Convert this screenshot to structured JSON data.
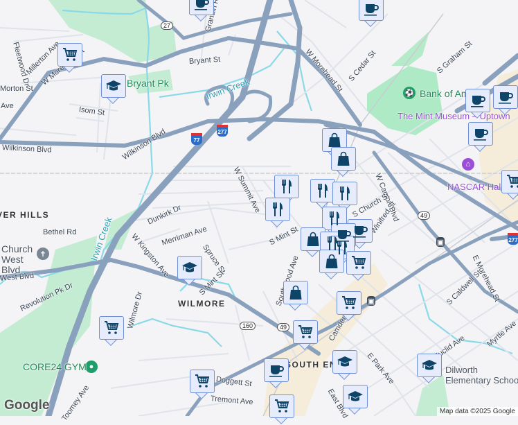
{
  "labels": {
    "fleetwood": "Fleetwood Dr",
    "millerton": "Millerton Ave",
    "w_morehead_w": "W Morehead St",
    "morton": "Morton St",
    "ave": "Ave",
    "isom": "Isom St",
    "bryant_st": "Bryant St",
    "grandin": "Grandin Rd",
    "wilkinson_1": "Wilkinson Blvd",
    "wilkinson_2": "Wilkinson Blvd",
    "w_summit": "W Summit Ave",
    "w_morehead_e": "W Morehead St",
    "s_cedar": "S Cedar St",
    "s_graham": "S Graham St",
    "w_carson": "W Carson Blvd",
    "s_church": "S Church St",
    "winifred": "Winifred St",
    "dunkirk": "Dunkirk Dr",
    "merriman": "Merriman Ave",
    "w_kingston": "W Kingston Ave",
    "spruce": "Spruce St",
    "s_mint_1": "S Mint St",
    "s_mint_2": "S Mint St",
    "bethel": "Bethel Rd",
    "west_blvd": "West Blvd",
    "revolution": "Revolution Pk Dr",
    "wilmore_dr": "Wilmore Dr",
    "southwood": "Southwood Ave",
    "camden": "Camden Rd",
    "e_park": "E Park Ave",
    "s_caldwell": "S Caldwell St",
    "e_morehead": "E Morehead St",
    "myrtle": "Myrtle Ave",
    "euclid": "Euclid Ave",
    "doggett": "Doggett St",
    "tremont": "Tremont Ave",
    "toomey": "Toomey Ave",
    "east": "East Blvd",
    "river_hills": "RIVER HILLS",
    "wilmore": "WILMORE",
    "south_end": "SOUTH END",
    "bryant_pk": "Bryant Pk",
    "irwin_creek_1": "Irwin Creek",
    "irwin_creek_2": "Irwin Creek",
    "bank_of_america": "Bank of America Stadium",
    "mint_museum": "The Mint Museum – Uptown",
    "nascar": "NASCAR Hall of Fame",
    "church": "Church West Blvd",
    "core24": "CORE24 GYM",
    "dilworth": "Dilworth Elementary School"
  },
  "shields": {
    "us27": "27",
    "us49a": "49",
    "us49b": "49",
    "nc160": "160",
    "i77": "77",
    "i277a": "277",
    "i277b": "277"
  },
  "markers": [
    "cart",
    "graduation-cap",
    "coffee",
    "coffee",
    "shopping-bag",
    "shopping-bag",
    "coffee",
    "coffee",
    "coffee",
    "cart",
    "restaurant",
    "restaurant",
    "restaurant",
    "restaurant",
    "restaurant",
    "coffee",
    "coffee",
    "shopping-bag",
    "restaurant",
    "restaurant",
    "shopping-bag",
    "cart",
    "graduation-cap",
    "shopping-bag",
    "cart",
    "cart",
    "cart",
    "graduation-cap",
    "coffee",
    "graduation-cap",
    "graduation-cap",
    "cart",
    "cart"
  ],
  "footer": {
    "google": "Google",
    "attribution": "Map data ©2025 Google"
  }
}
